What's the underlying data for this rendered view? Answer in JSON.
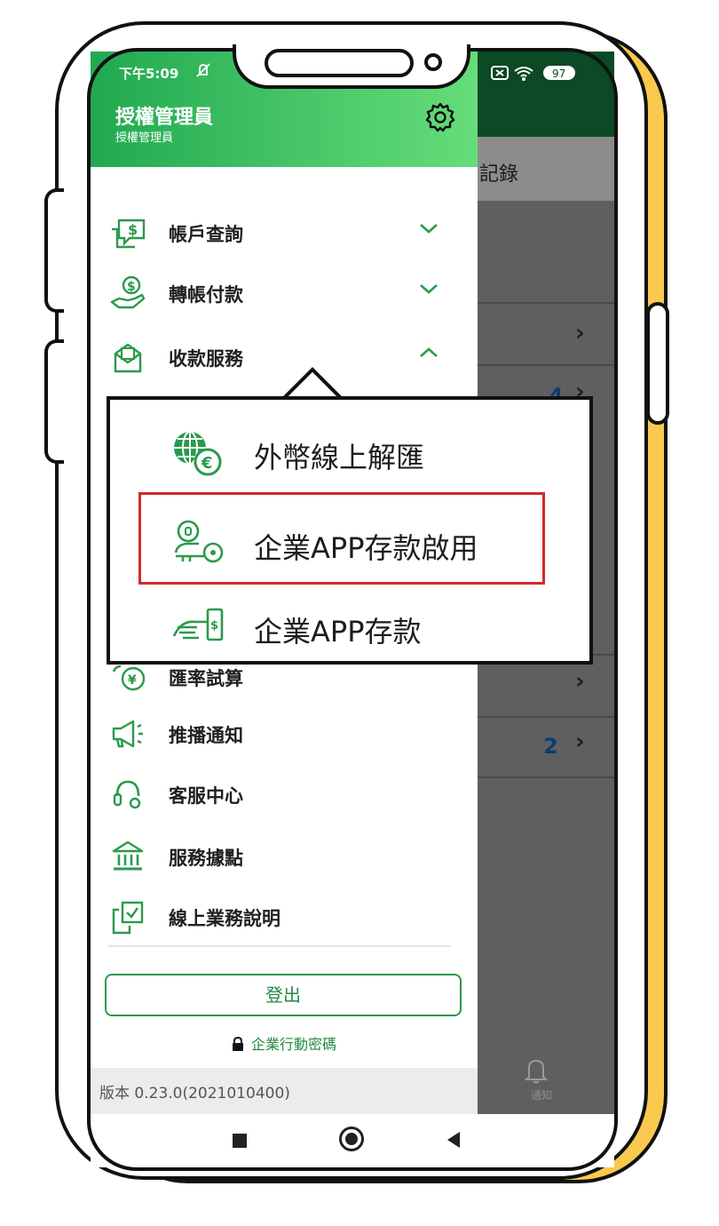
{
  "status_bar": {
    "time": "下午5:09",
    "battery": "97"
  },
  "drawer": {
    "user_name": "授權管理員",
    "user_role": "授權管理員",
    "menu": [
      {
        "label": "帳戶查詢",
        "icon": "account-query-icon",
        "expanded": false
      },
      {
        "label": "轉帳付款",
        "icon": "transfer-payment-icon",
        "expanded": false
      },
      {
        "label": "收款服務",
        "icon": "collection-service-icon",
        "expanded": true
      },
      {
        "label": "匯率試算",
        "icon": "exchange-calc-icon"
      },
      {
        "label": "推播通知",
        "icon": "megaphone-icon"
      },
      {
        "label": "客服中心",
        "icon": "headset-icon"
      },
      {
        "label": "服務據點",
        "icon": "bank-icon"
      },
      {
        "label": "線上業務說明",
        "icon": "online-guide-icon"
      }
    ],
    "logout_label": "登出",
    "mobile_password_label": "企業行動密碼",
    "version": "版本 0.23.0(2021010400)"
  },
  "submenu_popup": [
    {
      "label": "外幣線上解匯",
      "icon": "globe-euro-icon"
    },
    {
      "label": "企業APP存款啟用",
      "icon": "key-activation-icon",
      "highlighted": true
    },
    {
      "label": "企業APP存款",
      "icon": "hand-deposit-icon"
    }
  ],
  "background_app": {
    "tab_label": "記錄",
    "badge_1": "4",
    "badge_2": "2",
    "bottom_nav_label": "通知"
  },
  "colors": {
    "brand_green": "#21a950",
    "dark_green": "#0b4a24",
    "highlight_red": "#d22a2a",
    "phone_yellow": "#f9c94f"
  }
}
